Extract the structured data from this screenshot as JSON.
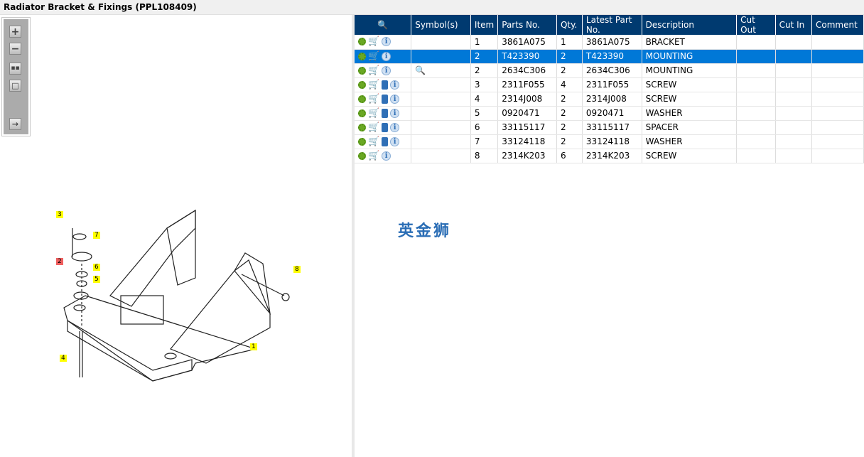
{
  "title": "Radiator Bracket & Fixings (PPL108409)",
  "watermark": "英金狮",
  "table": {
    "headers": [
      "Symbol(s)",
      "Item",
      "Parts No.",
      "Qty.",
      "Latest Part No.",
      "Description",
      "Cut Out",
      "Cut In",
      "Comment"
    ],
    "rows": [
      {
        "item": "1",
        "part": "3861A075",
        "qty": "1",
        "latest": "3861A075",
        "desc": "BRACKET",
        "book": false,
        "symbol": false
      },
      {
        "item": "2",
        "part": "T423390",
        "qty": "2",
        "latest": "T423390",
        "desc": "MOUNTING",
        "book": false,
        "symbol": false,
        "selected": true
      },
      {
        "item": "2",
        "part": "2634C306",
        "qty": "2",
        "latest": "2634C306",
        "desc": "MOUNTING",
        "book": false,
        "symbol": true
      },
      {
        "item": "3",
        "part": "2311F055",
        "qty": "4",
        "latest": "2311F055",
        "desc": "SCREW",
        "book": true,
        "symbol": false
      },
      {
        "item": "4",
        "part": "2314J008",
        "qty": "2",
        "latest": "2314J008",
        "desc": "SCREW",
        "book": true,
        "symbol": false
      },
      {
        "item": "5",
        "part": "0920471",
        "qty": "2",
        "latest": "0920471",
        "desc": "WASHER",
        "book": true,
        "symbol": false
      },
      {
        "item": "6",
        "part": "33115117",
        "qty": "2",
        "latest": "33115117",
        "desc": "SPACER",
        "book": true,
        "symbol": false
      },
      {
        "item": "7",
        "part": "33124118",
        "qty": "2",
        "latest": "33124118",
        "desc": "WASHER",
        "book": true,
        "symbol": false
      },
      {
        "item": "8",
        "part": "2314K203",
        "qty": "6",
        "latest": "2314K203",
        "desc": "SCREW",
        "book": false,
        "symbol": false
      }
    ]
  },
  "callouts": [
    "1",
    "2",
    "3",
    "4",
    "5",
    "6",
    "7",
    "8"
  ],
  "colors": {
    "header": "#003a70",
    "selected": "#0078d7"
  }
}
